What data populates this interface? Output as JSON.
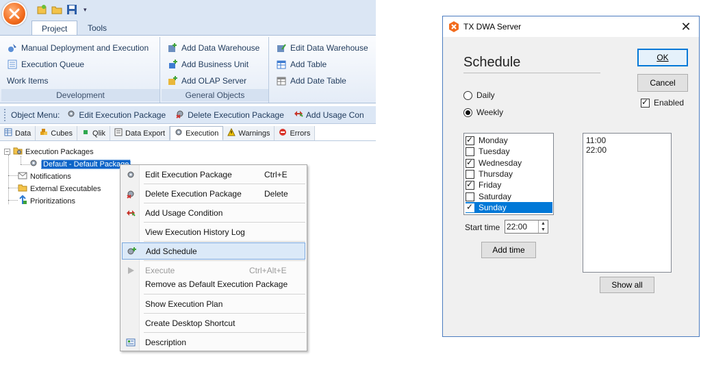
{
  "app": {
    "ribbon_tabs": [
      "Project",
      "Tools"
    ],
    "groups": {
      "development": {
        "label": "Development",
        "items": [
          "Manual Deployment and Execution",
          "Execution Queue",
          "Work Items"
        ]
      },
      "general_objects": {
        "label": "General Objects",
        "items": [
          "Add Data Warehouse",
          "Add Business Unit",
          "Add OLAP Server"
        ]
      },
      "third": {
        "items": [
          "Edit Data Warehouse",
          "Add Table",
          "Add Date Table"
        ]
      }
    },
    "object_menu": {
      "label": "Object Menu:",
      "items": [
        "Edit Execution Package",
        "Delete Execution Package",
        "Add Usage Con"
      ]
    },
    "doc_tabs": [
      "Data",
      "Cubes",
      "Qlik",
      "Data Export",
      "Execution",
      "Warnings",
      "Errors"
    ],
    "active_doc_tab": "Execution",
    "tree": {
      "execution_packages": "Execution Packages",
      "default_package": "Default - Default Package",
      "notifications": "Notifications",
      "external_executables": "External Executables",
      "prioritizations": "Prioritizations"
    },
    "context_menu": [
      {
        "label": "Edit Execution Package",
        "shortcut": "Ctrl+E"
      },
      {
        "label": "Delete Execution Package",
        "shortcut": "Delete"
      },
      {
        "label": "Add Usage Condition",
        "shortcut": ""
      },
      {
        "label": "View Execution History Log",
        "shortcut": ""
      },
      {
        "label": "Add Schedule",
        "shortcut": ""
      },
      {
        "label": "Execute",
        "shortcut": "Ctrl+Alt+E"
      },
      {
        "label": "Remove as Default Execution Package",
        "shortcut": ""
      },
      {
        "label": "Show Execution Plan",
        "shortcut": ""
      },
      {
        "label": "Create Desktop Shortcut",
        "shortcut": ""
      },
      {
        "label": "Description",
        "shortcut": ""
      }
    ]
  },
  "dialog": {
    "title": "TX DWA Server",
    "close_glyph": "✕",
    "heading": "Schedule",
    "ok_label": "OK",
    "cancel_label": "Cancel",
    "enabled_label": "Enabled",
    "enabled_checked": true,
    "frequency": {
      "daily_label": "Daily",
      "weekly_label": "Weekly",
      "selected": "Weekly"
    },
    "days": [
      {
        "label": "Monday",
        "checked": true
      },
      {
        "label": "Tuesday",
        "checked": false
      },
      {
        "label": "Wednesday",
        "checked": true
      },
      {
        "label": "Thursday",
        "checked": false
      },
      {
        "label": "Friday",
        "checked": true
      },
      {
        "label": "Saturday",
        "checked": false
      },
      {
        "label": "Sunday",
        "checked": true
      }
    ],
    "selected_day": "Sunday",
    "start_time_label": "Start time",
    "start_time_value": "22:00",
    "add_time_label": "Add time",
    "times": [
      "11:00",
      "22:00"
    ],
    "show_all_label": "Show all"
  },
  "colors": {
    "accent": "#0078d7",
    "ribbon": "#dbe6f4",
    "orange": "#f26b1d"
  }
}
